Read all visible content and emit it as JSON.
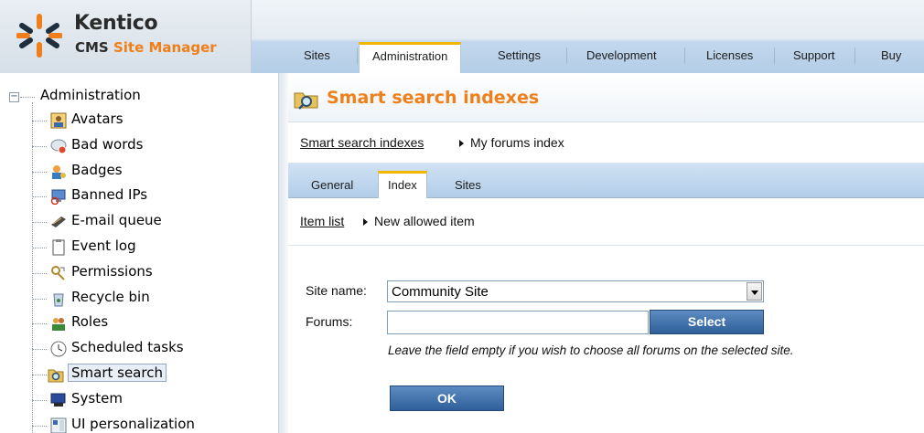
{
  "header": {
    "logo_brand": "Kentico",
    "logo_product_prefix": "CMS ",
    "logo_product_accent": "Site Manager",
    "tabs": [
      {
        "label": "Sites"
      },
      {
        "label": "Administration",
        "active": true
      },
      {
        "label": "Settings"
      },
      {
        "label": "Development"
      },
      {
        "label": "Licenses"
      },
      {
        "label": "Support"
      },
      {
        "label": "Buy"
      }
    ]
  },
  "sidebar": {
    "expander": "−",
    "root_label": "Administration",
    "items": [
      {
        "label": "Avatars",
        "icon": "avatar-icon"
      },
      {
        "label": "Bad words",
        "icon": "bad-words-icon"
      },
      {
        "label": "Badges",
        "icon": "badges-icon"
      },
      {
        "label": "Banned IPs",
        "icon": "banned-ips-icon"
      },
      {
        "label": "E-mail queue",
        "icon": "email-queue-icon"
      },
      {
        "label": "Event log",
        "icon": "event-log-icon"
      },
      {
        "label": "Permissions",
        "icon": "permissions-icon"
      },
      {
        "label": "Recycle bin",
        "icon": "recycle-bin-icon"
      },
      {
        "label": "Roles",
        "icon": "roles-icon"
      },
      {
        "label": "Scheduled tasks",
        "icon": "scheduled-tasks-icon"
      },
      {
        "label": "Smart search",
        "icon": "smart-search-icon",
        "selected": true
      },
      {
        "label": "System",
        "icon": "system-icon"
      },
      {
        "label": "UI personalization",
        "icon": "ui-personalization-icon"
      }
    ]
  },
  "main": {
    "title": "Smart search indexes",
    "breadcrumb": {
      "link": "Smart search indexes",
      "current": "My forums index"
    },
    "subtabs": [
      {
        "label": "General"
      },
      {
        "label": "Index",
        "active": true
      },
      {
        "label": "Sites"
      }
    ],
    "breadcrumb2": {
      "link": "Item list",
      "current": "New allowed item"
    },
    "form": {
      "site_name_label": "Site name:",
      "site_name_value": "Community Site",
      "forums_label": "Forums:",
      "forums_value": "",
      "select_button": "Select",
      "hint": "Leave the field empty if you wish to choose all forums on the selected site.",
      "ok_button": "OK"
    }
  },
  "colors": {
    "accent_orange": "#ef7f1a",
    "tab_highlight": "#f3b500",
    "button_blue": "#3b6aa4"
  }
}
